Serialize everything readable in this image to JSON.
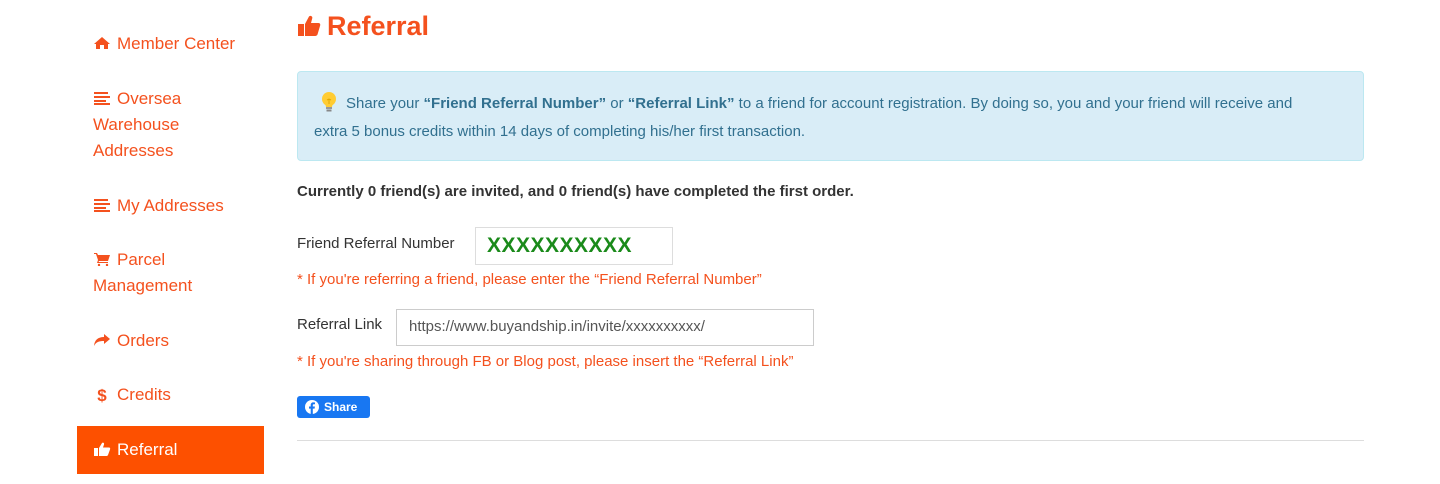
{
  "sidebar": {
    "items": [
      {
        "label": "Member Center",
        "icon": "home-icon",
        "active": false
      },
      {
        "label": "Oversea",
        "label2": "Warehouse",
        "label3": "Addresses",
        "icon": "list-icon",
        "active": false
      },
      {
        "label": "My Addresses",
        "icon": "list-icon",
        "active": false
      },
      {
        "label": "Parcel",
        "label2": "Management",
        "icon": "cart-icon",
        "active": false
      },
      {
        "label": "Orders",
        "icon": "share-arrow-icon",
        "active": false
      },
      {
        "label": "Credits",
        "icon": "dollar-icon",
        "active": false
      },
      {
        "label": "Referral",
        "icon": "thumbs-up-icon",
        "active": true
      }
    ]
  },
  "page": {
    "title": "Referral",
    "title_icon": "thumbs-up-icon"
  },
  "info": {
    "icon": "lightbulb-icon",
    "text_1": "Share your ",
    "strong_1": "“Friend Referral Number”",
    "text_2": " or ",
    "strong_2": "“Referral Link”",
    "text_3": " to a friend for account registration. By doing so, you and your friend will receive and",
    "line_2": "extra 5 bonus credits within 14 days of completing his/her first transaction."
  },
  "stats": "Currently 0 friend(s) are invited, and 0 friend(s) have completed the first order.",
  "referral_number": {
    "label": "Friend Referral Number",
    "value": "XXXXXXXXXX",
    "hint": "* If you're referring a friend, please enter the “Friend Referral Number”"
  },
  "referral_link": {
    "label": "Referral Link",
    "value": "https://www.buyandship.in/invite/xxxxxxxxxx/",
    "hint": "* If you're sharing through FB or Blog post, please insert the “Referral Link”"
  },
  "share_button": {
    "label": "Share",
    "icon": "facebook-icon"
  },
  "colors": {
    "accent": "#f4511e",
    "active_bg": "#fd5000",
    "info_bg": "#d9edf7",
    "info_text": "#31708f",
    "code_text": "#1a8a1a",
    "facebook_blue": "#1877f2"
  }
}
